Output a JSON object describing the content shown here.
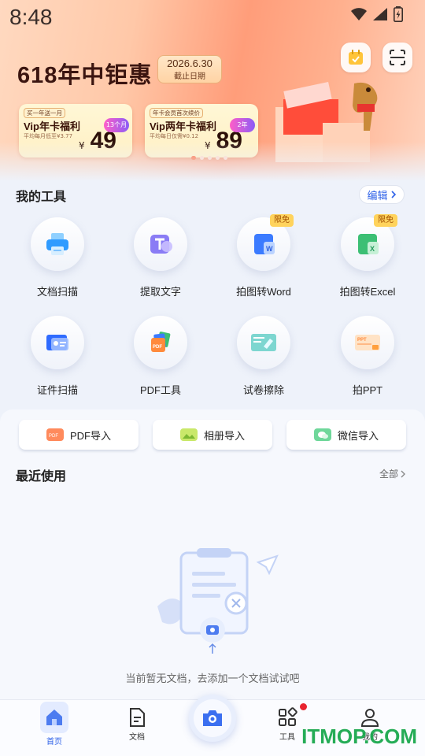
{
  "status": {
    "time": "8:48"
  },
  "banner": {
    "title": "618年中钜惠",
    "date": "2026.6.30",
    "date_caption": "截止日期",
    "cards": [
      {
        "tag": "买一年送一月",
        "name": "Vip年卡福利",
        "sub": "平均每月低至¥3.77",
        "yen": "¥",
        "price": "49",
        "badge": "13个月"
      },
      {
        "tag": "年卡会员首次续价",
        "name": "Vip两年卡福利",
        "sub": "平均每日仅需¥0.12",
        "yen": "¥",
        "price": "89",
        "badge": "2年"
      }
    ],
    "slides_count": 5,
    "active_slide": 1
  },
  "my_tools": {
    "title": "我的工具",
    "edit_label": "编辑",
    "items": [
      {
        "label": "文档扫描",
        "icon": "printer-scan-icon"
      },
      {
        "label": "提取文字",
        "icon": "text-extract-icon"
      },
      {
        "label": "拍图转Word",
        "icon": "word-icon",
        "badge": "限免"
      },
      {
        "label": "拍图转Excel",
        "icon": "excel-icon",
        "badge": "限免"
      },
      {
        "label": "证件扫描",
        "icon": "id-card-icon"
      },
      {
        "label": "PDF工具",
        "icon": "pdf-tools-icon"
      },
      {
        "label": "试卷擦除",
        "icon": "exam-erase-icon"
      },
      {
        "label": "拍PPT",
        "icon": "ppt-icon"
      }
    ]
  },
  "imports": [
    {
      "label": "PDF导入",
      "icon": "pdf-import-icon",
      "color": "#ff7a45"
    },
    {
      "label": "相册导入",
      "icon": "album-import-icon",
      "color": "#a3d84a"
    },
    {
      "label": "微信导入",
      "icon": "wechat-import-icon",
      "color": "#3cc07a"
    }
  ],
  "recent": {
    "title": "最近使用",
    "all_label": "全部",
    "empty_text": "当前暂无文档，去添加一个文档试试吧"
  },
  "nav": {
    "home": "首页",
    "docs": "文档",
    "tools": "工具",
    "mine": "我的"
  },
  "watermark": "ITMOP.COM",
  "colors": {
    "accent": "#2f62e8",
    "banner_orange": "#ff9d7a",
    "badge_yellow": "#ffd35c",
    "red_dot": "#e8242f"
  }
}
